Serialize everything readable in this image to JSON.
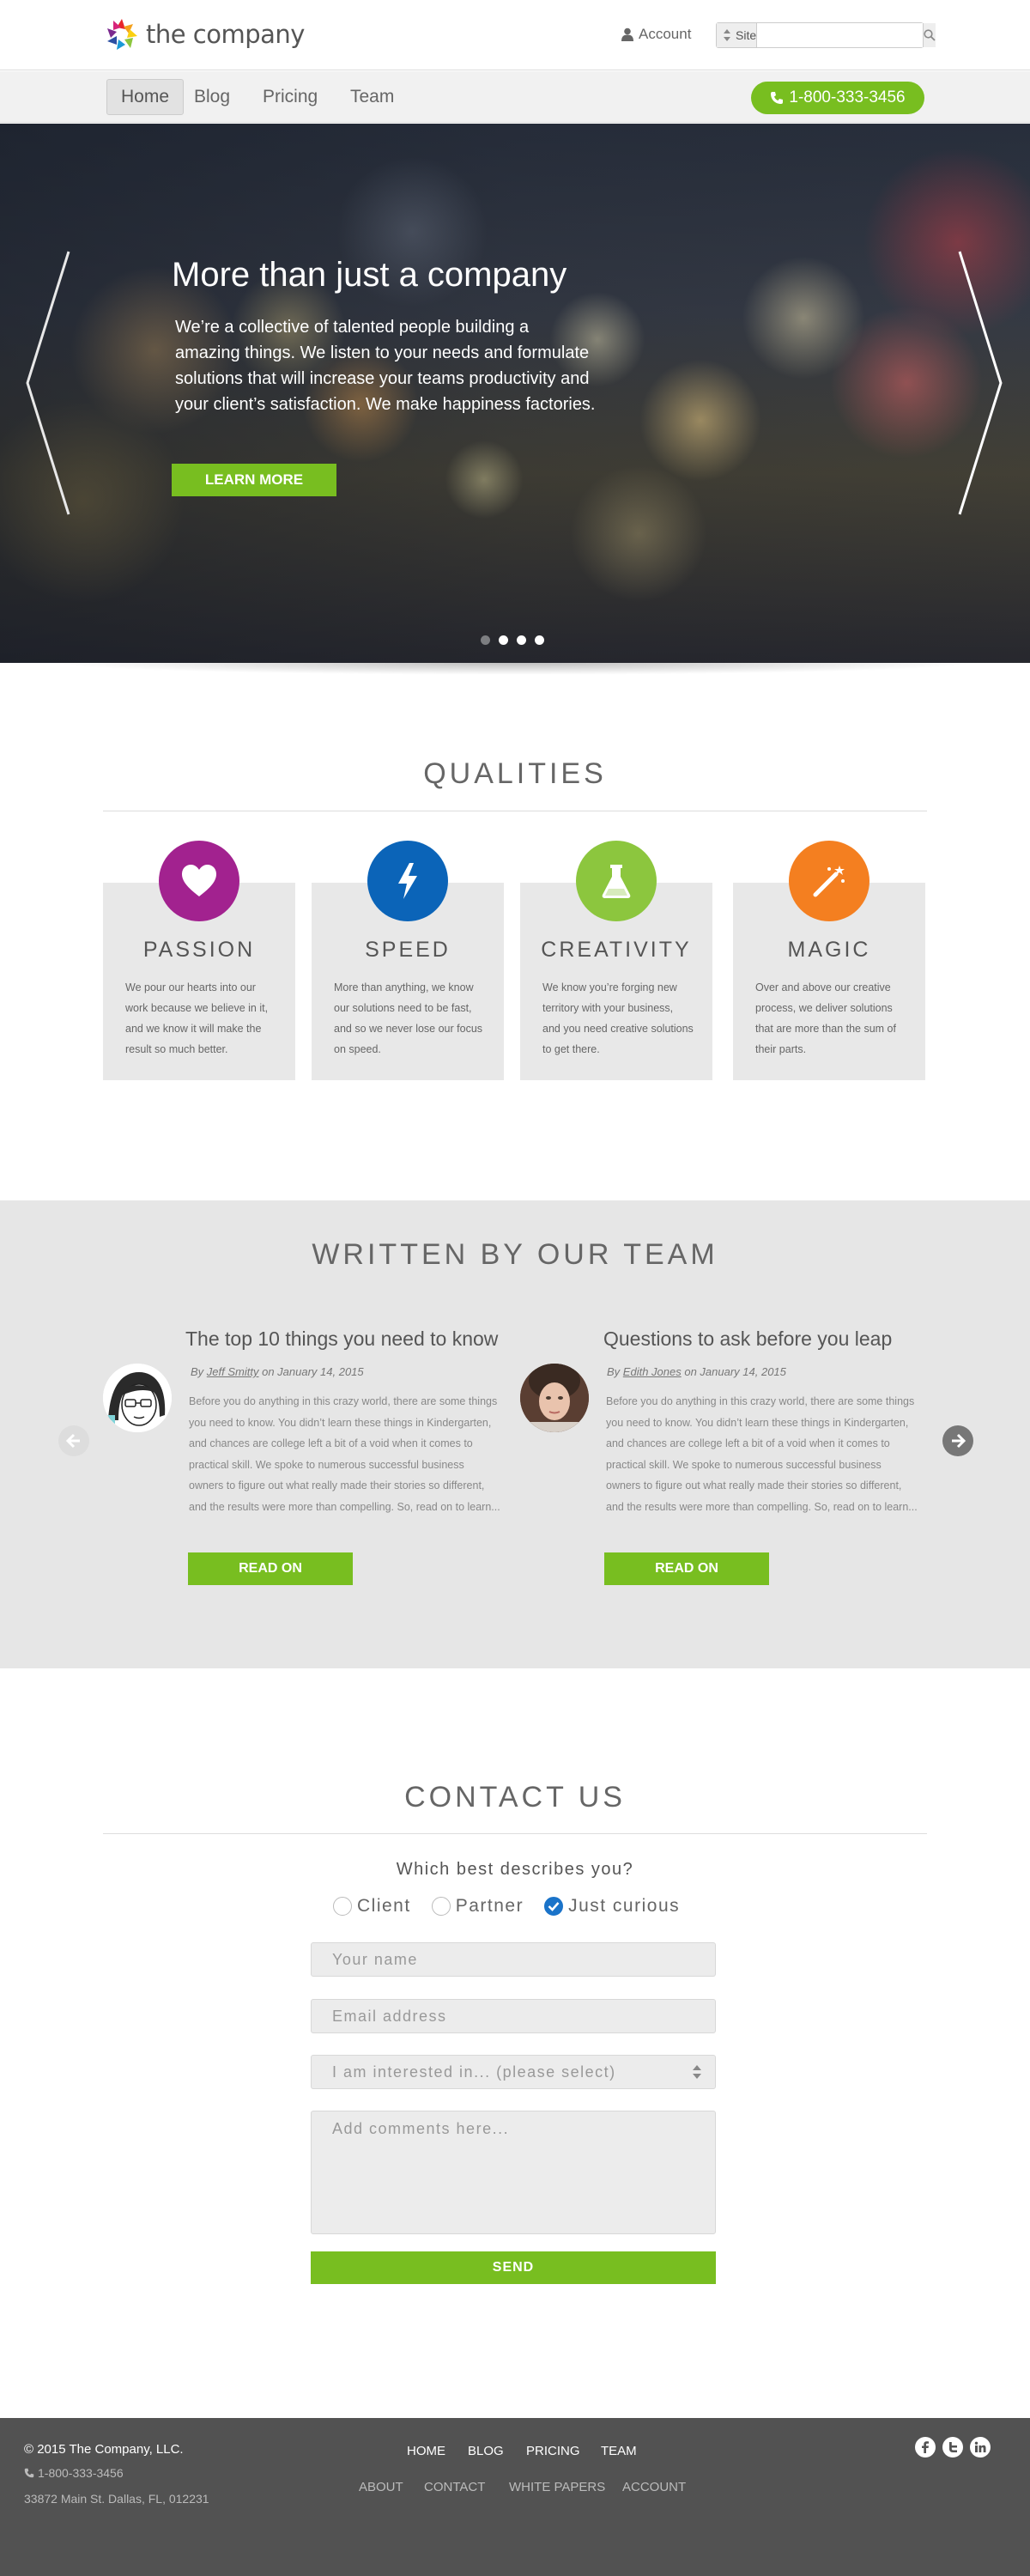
{
  "header": {
    "logo_text": "the company",
    "account_label": "Account",
    "search": {
      "scope_label": "Site",
      "placeholder": ""
    }
  },
  "nav": {
    "items": [
      {
        "label": "Home",
        "active": true
      },
      {
        "label": "Blog"
      },
      {
        "label": "Pricing"
      },
      {
        "label": "Team"
      }
    ],
    "phone_label": "1-800-333-3456"
  },
  "hero": {
    "title": "More than just a company",
    "text": "We’re a collective of talented people building a amazing things. We listen to your needs and formulate solutions that will increase your teams productivity and your client’s satisfaction. We make happiness factories.",
    "button_label": "LEARN MORE",
    "slide_count": 4,
    "active_slide": 2
  },
  "qualities": {
    "title": "QUALITIES",
    "items": [
      {
        "title": "PASSION",
        "icon": "heart-icon",
        "color": "#a2228f",
        "text": "We pour our hearts into our work because we believe in it, and we know it will make the result so much better."
      },
      {
        "title": "SPEED",
        "icon": "lightning-icon",
        "color": "#0b64b8",
        "text": "More than anything, we know our solutions need to be fast, and so we never lose our focus on speed."
      },
      {
        "title": "CREATIVITY",
        "icon": "flask-icon",
        "color": "#8cc63e",
        "text": "We know you’re forging new territory with your business, and you need creative solutions to get there."
      },
      {
        "title": "MAGIC",
        "icon": "magic-wand-icon",
        "color": "#f47f20",
        "text": "Over and above our creative process, we deliver solutions that are more than the sum of their parts."
      }
    ]
  },
  "blog": {
    "title": "WRITTEN BY OUR TEAM",
    "posts": [
      {
        "title": "The top 10 things you need to know",
        "by": "By",
        "author": "Jeff Smitty",
        "date": "on January 14, 2015",
        "text": "Before you do anything in this crazy world, there are some things you need to know. You didn’t learn these things in Kindergarten, and chances are college left a bit of a void when it comes to practical skill. We spoke to numerous successful business owners to figure out what really made their stories so different, and the results were more than compelling. So, read on to learn...",
        "button_label": "READ ON"
      },
      {
        "title": "Questions to ask before you leap",
        "by": "By",
        "author": "Edith Jones",
        "date": "on January 14, 2015",
        "text": "Before you do anything in this crazy world, there are some things you need to know. You didn’t learn these things in Kindergarten, and chances are college left a bit of a void when it comes to practical skill. We spoke to numerous successful business owners to figure out what really made their stories so different, and the results were more than compelling. So, read on to learn...",
        "button_label": "READ ON"
      }
    ]
  },
  "contact": {
    "title": "CONTACT US",
    "question": "Which best describes you?",
    "options": [
      {
        "label": "Client",
        "checked": false
      },
      {
        "label": "Partner",
        "checked": false
      },
      {
        "label": "Just curious",
        "checked": true
      }
    ],
    "name_placeholder": "Your name",
    "email_placeholder": "Email address",
    "interest_placeholder": "I am interested in... (please select)",
    "comments_placeholder": "Add comments here...",
    "send_label": "SEND"
  },
  "footer": {
    "copyright": "© 2015 The Company, LLC.",
    "phone": "1-800-333-3456",
    "address": "33872 Main St. Dallas, FL, 012231",
    "primary_links": [
      "HOME",
      "BLOG",
      "PRICING",
      "TEAM"
    ],
    "secondary_links": [
      "ABOUT",
      "CONTACT",
      "WHITE PAPERS",
      "ACCOUNT"
    ],
    "social": [
      "facebook-icon",
      "twitter-icon",
      "linkedin-icon"
    ]
  },
  "colors": {
    "accent_green": "#78be20",
    "footer_bg": "#525252",
    "checked_blue": "#1a73c9"
  }
}
